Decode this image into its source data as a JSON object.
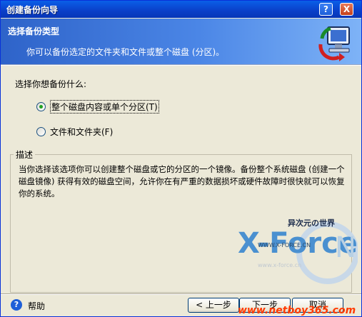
{
  "window": {
    "title": "创建备份向导",
    "help_btn": "?",
    "close_btn": "X"
  },
  "banner": {
    "title": "选择备份类型",
    "subtitle": "你可以备份选定的文件夹和文件或整个磁盘 (分区)。"
  },
  "form": {
    "prompt": "选择你想备份什么:",
    "options": [
      {
        "label": "整个磁盘内容或单个分区(T)",
        "checked": true
      },
      {
        "label": "文件和文件夹(F)",
        "checked": false
      }
    ]
  },
  "description": {
    "title": "描述",
    "text": "当你选择该选项你可以创建整个磁盘或它的分区的一个镜像。备份整个系统磁盘 (创建一个磁盘镜像) 获得有效的磁盘空间，允许你在有严重的数据损坏或硬件故障时很快就可以恢复你的系统。"
  },
  "watermark": {
    "brand": "X-Force",
    "suffix": "N",
    "cn_text": "异次元の世界",
    "url1": "WWW.X-FORCE.CN",
    "url2": "www.x-force.cn"
  },
  "footer": {
    "help_label": "帮助",
    "back": "< 上一步",
    "next": "下一步",
    "cancel": "取消",
    "overlay_url": "www.netboy365.com"
  }
}
